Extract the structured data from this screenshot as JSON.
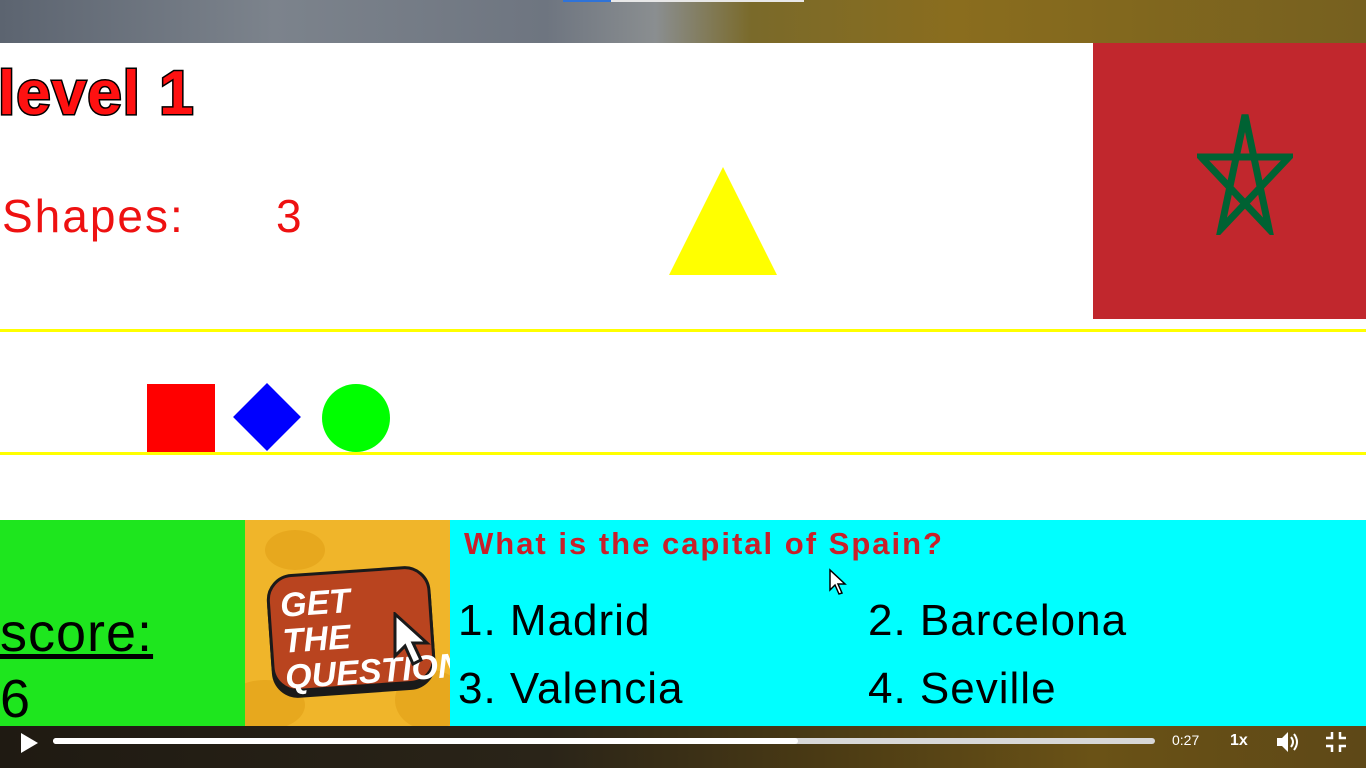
{
  "level": {
    "title": "level 1"
  },
  "shapes": {
    "label": "Shapes:",
    "count": "3"
  },
  "target_shape": {
    "type": "triangle",
    "color": "#ffff00"
  },
  "flag": {
    "name": "morocco-flag",
    "background": "#c1272d",
    "star_color": "#006233"
  },
  "shape_row": [
    {
      "type": "square",
      "color": "#ff0000"
    },
    {
      "type": "diamond",
      "color": "#0000ff"
    },
    {
      "type": "circle",
      "color": "#00ff00"
    }
  ],
  "score": {
    "label": "score:",
    "value": "6"
  },
  "get_question": {
    "text": "GET THE QUESTION"
  },
  "quiz": {
    "question": "What is the capital of Spain?",
    "answers": [
      "1. Madrid",
      "2. Barcelona",
      "3. Valencia",
      "4. Seville"
    ]
  },
  "player": {
    "time": "0:27",
    "speed": "1x",
    "progress": 0.676
  }
}
